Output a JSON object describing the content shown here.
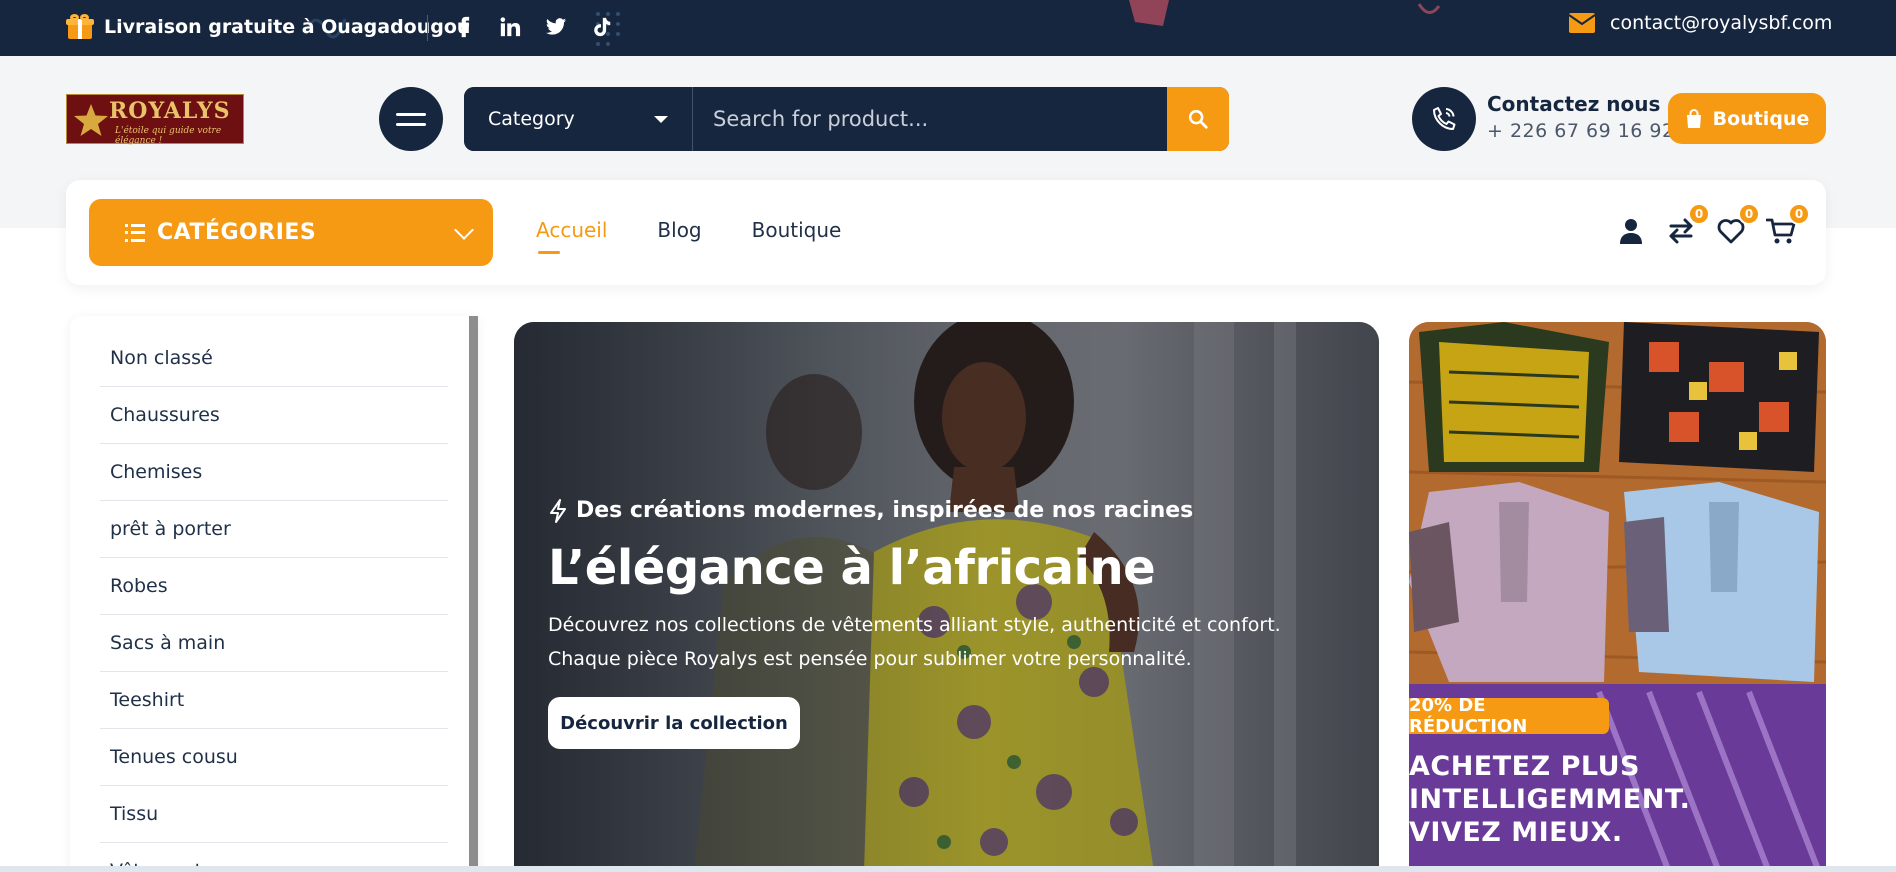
{
  "topbar": {
    "promo_text": "Livraison gratuite à Ouagadougou",
    "email": "contact@royalysbf.com",
    "social_icons": [
      "facebook-icon",
      "linkedin-icon",
      "twitter-icon",
      "tiktok-icon"
    ]
  },
  "header": {
    "logo_name": "ROYALYS",
    "logo_tagline": "L'étoile qui guide votre élégance !",
    "search": {
      "category_label": "Category",
      "placeholder": "Search for product..."
    },
    "contact_title": "Contactez nous",
    "contact_phone": "+ 226 67 69 16 92",
    "shop_button": "Boutique"
  },
  "nav": {
    "categories_button": "CATÉGORIES",
    "links": [
      {
        "label": "Accueil",
        "active": true
      },
      {
        "label": "Blog",
        "active": false
      },
      {
        "label": "Boutique",
        "active": false
      }
    ],
    "compare_count": "0",
    "wishlist_count": "0",
    "cart_count": "0"
  },
  "sidebar": {
    "items": [
      "Non classé",
      "Chaussures",
      "Chemises",
      "prêt à porter",
      "Robes",
      "Sacs à main",
      "Teeshirt",
      "Tenues cousu",
      "Tissu",
      "Vêtements"
    ]
  },
  "hero": {
    "kicker": "Des créations modernes, inspirées de nos racines",
    "title": "L’élégance à l’africaine",
    "description": "Découvrez nos collections de vêtements alliant style, authenticité et confort. Chaque pièce Royalys est pensée pour sublimer votre personnalité.",
    "cta": "Découvrir la collection"
  },
  "side_banner": {
    "badge": "20% DE RÉDUCTION",
    "line1": "ACHETEZ PLUS",
    "line2": "INTELLIGEMMENT.",
    "line3": "VIVEZ MIEUX."
  },
  "colors": {
    "navy": "#17263f",
    "accent": "#f59a12"
  }
}
